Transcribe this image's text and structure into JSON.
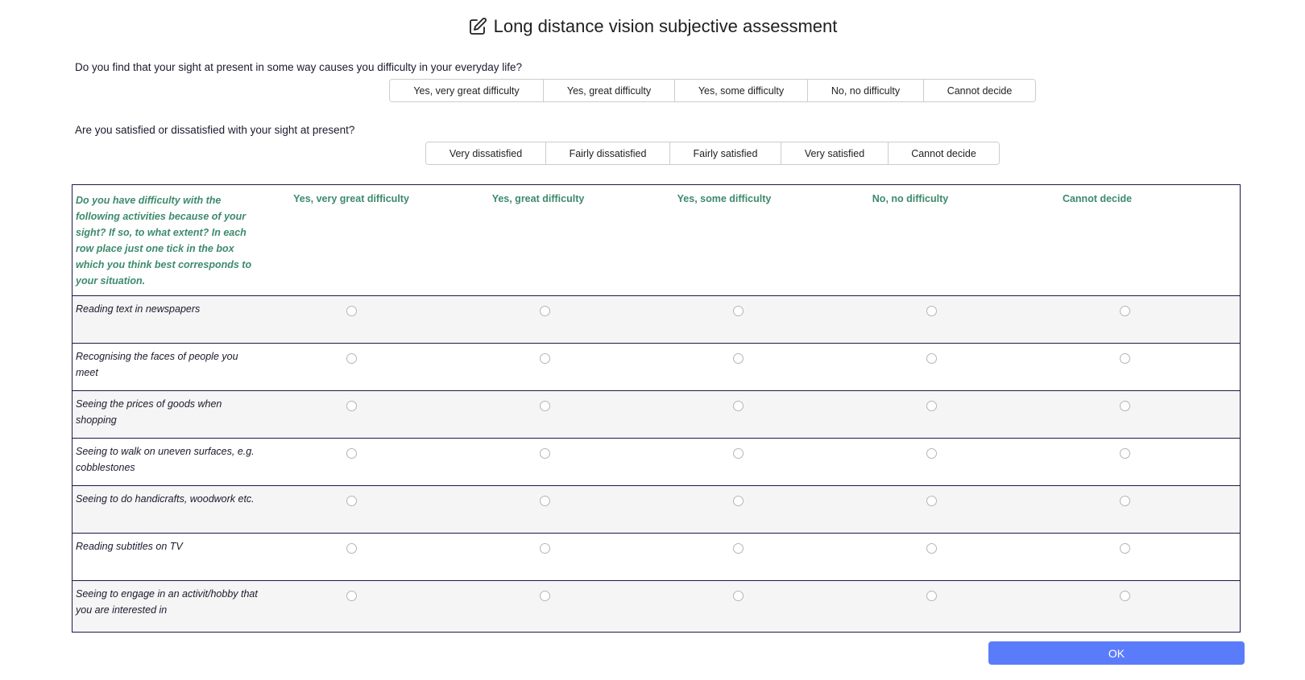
{
  "title": "Long distance vision subjective assessment",
  "title_icon": "edit-icon",
  "q1": {
    "question": "Do you find that your sight at present in some way causes you difficulty in your everyday life?",
    "options": [
      "Yes, very great difficulty",
      "Yes, great difficulty",
      "Yes, some difficulty",
      "No, no difficulty",
      "Cannot decide"
    ]
  },
  "q2": {
    "question": "Are you satisfied or dissatisfied with your sight at present?",
    "options": [
      "Very dissatisfied",
      "Fairly dissatisfied",
      "Fairly satisfied",
      "Very satisfied",
      "Cannot decide"
    ]
  },
  "grid": {
    "intro": "Do you have difficulty with the following activities because of your sight? If so, to what extent?  In each row place just one tick in the box which you think best corresponds to your situation.",
    "columns": [
      "Yes, very great difficulty",
      "Yes, great difficulty",
      "Yes, some difficulty",
      "No, no difficulty",
      "Cannot decide"
    ],
    "rows": [
      "Reading text in newspapers",
      "Recognising the faces of people you meet",
      "Seeing the prices of goods when shopping",
      "Seeing to walk on uneven surfaces, e.g. cobblestones",
      "Seeing to do handicrafts, woodwork etc.",
      "Reading subtitles on TV",
      "Seeing to engage in an activit/hobby that you are interested in"
    ]
  },
  "ok_label": "OK",
  "colors": {
    "header_green": "#3d8a6c",
    "ok_blue": "#5b7cfa",
    "grid_border": "#1a1a4a",
    "stripe": "#f5f5f5"
  }
}
